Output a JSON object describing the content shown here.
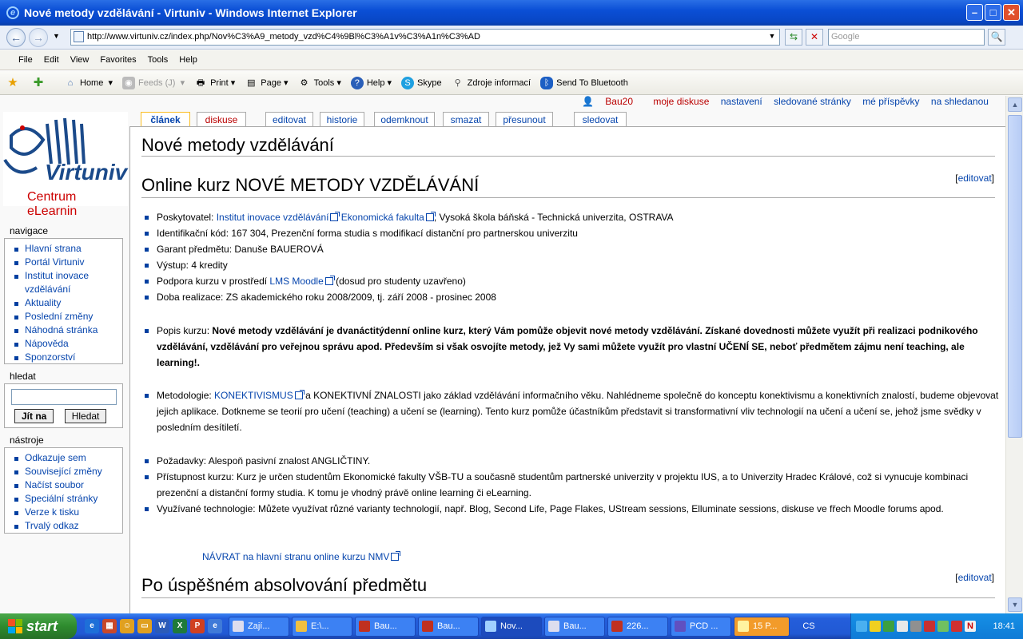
{
  "window": {
    "title": "Nové metody vzdělávání - Virtuniv - Windows Internet Explorer"
  },
  "address": {
    "url": "http://www.virtuniv.cz/index.php/Nov%C3%A9_metody_vzd%C4%9Bl%C3%A1v%C3%A1n%C3%AD",
    "search_placeholder": "Google"
  },
  "menu": [
    "File",
    "Edit",
    "View",
    "Favorites",
    "Tools",
    "Help"
  ],
  "commandbar": {
    "home": "Home",
    "feeds": "Feeds (J)",
    "print": "Print",
    "page": "Page",
    "tools": "Tools",
    "help": "Help",
    "skype": "Skype",
    "zdroje": "Zdroje informací",
    "bluetooth": "Send To Bluetooth"
  },
  "logo": {
    "name": "Virtuniv",
    "subtitle": "Centrum eLearnin"
  },
  "personal": {
    "user": "Bau20",
    "items": [
      "moje diskuse",
      "nastavení",
      "sledované stránky",
      "mé příspěvky",
      "na shledanou"
    ]
  },
  "tabs": [
    "článek",
    "diskuse",
    "editovat",
    "historie",
    "odemknout",
    "smazat",
    "přesunout",
    "sledovat"
  ],
  "sidebar": {
    "nav_title": "navigace",
    "nav": [
      "Hlavní strana",
      "Portál Virtuniv",
      "Institut inovace",
      "vzdělávání",
      "Aktuality",
      "Poslední změny",
      "Náhodná stránka",
      "Nápověda",
      "Sponzorství"
    ],
    "search_title": "hledat",
    "go": "Jít na",
    "search": "Hledat",
    "tools_title": "nástroje",
    "tools": [
      "Odkazuje sem",
      "Související změny",
      "Načíst soubor",
      "Speciální stránky",
      "Verze k tisku",
      "Trvalý odkaz"
    ]
  },
  "article": {
    "title": "Nové metody vzdělávání",
    "h2": "Online kurz NOVÉ METODY VZDĚLÁVÁNÍ",
    "edit_open": "[",
    "edit": "editovat",
    "edit_close": "]",
    "provider_label": "Poskytovatel: ",
    "provider_link1": "Institut inovace vzdělávání",
    "provider_link2": "Ekonomická fakulta",
    "provider_rest": ", Vysoká škola báňská - Technická univerzita, OSTRAVA",
    "id": "Identifikační kód: 167 304, Prezenční forma studia s modifikací distanční pro partnerskou univerzitu",
    "garant": "Garant předmětu: Danuše BAUEROVÁ",
    "vystup": "Výstup: 4 kredity",
    "podpora_a": "Podpora kurzu v prostředí ",
    "podpora_link": "LMS Moodle",
    "podpora_b": " (dosud pro studenty uzavřeno)",
    "doba": "Doba realizace: ZS akademického roku 2008/2009, tj. září 2008 - prosinec 2008",
    "popis_label": "Popis kurzu: ",
    "popis_bold": "Nové metody vzdělávání je dvanáctitýdenní online kurz, který Vám pomůže objevit nové metody vzdělávání. Získané dovednosti můžete využít při realizaci podnikového vzdělávání, vzdělávání pro veřejnou správu apod. Především si však osvojíte metody, jež Vy sami můžete využít pro vlastní UČENÍ SE, neboť předmětem zájmu není teaching, ale learning!.",
    "metod_label": "Metodologie: ",
    "metod_link": "KONEKTIVISMUS",
    "metod_rest": " a KONEKTIVNÍ ZNALOSTI jako základ vzdělávání informačního věku. Nahlédneme společně do konceptu konektivismu a konektivních znalostí, budeme objevovat jejich aplikace. Dotkneme se teorií pro učení (teaching) a učení se (learning). Tento kurz pomůže účastníkům představit si transformativní vliv technologií na učení a učení se, jehož jsme svědky v posledním desítiletí.",
    "pozad": "Požadavky: Alespoň pasivní znalost ANGLIČTINY.",
    "pristup": "Přístupnost kurzu: Kurz je určen studentům Ekonomické fakulty VŠB-TU a současně studentům partnerské univerzity v projektu IUS, a to Univerzity Hradec Králové, což si vynucuje kombinaci prezenční a distanční formy studia. K tomu je vhodný právě online learning či eLearning.",
    "tech": "Využívané technologie: Můžete využívat různé varianty technologií, např. Blog, Second Life, Page Flakes, UStream sessions, Elluminate sessions, diskuse ve fřech Moodle forums apod.",
    "back": "NÁVRAT na hlavní stranu online kurzu NMV",
    "h2b": "Po úspěšném absolvování předmětu"
  },
  "taskbar": {
    "start": "start",
    "tasks": [
      "Zají...",
      "E:\\...",
      "Bau...",
      "Bau...",
      "Nov...",
      "Bau...",
      "226...",
      "PCD ...",
      "15 P..."
    ],
    "lang": "CS",
    "clock": "18:41"
  },
  "colors": {
    "link": "#0645ad",
    "new_link": "#ba0000",
    "tab_selected": "#fabd23",
    "taskbar": "#245edb",
    "start": "#2e8b2e"
  }
}
